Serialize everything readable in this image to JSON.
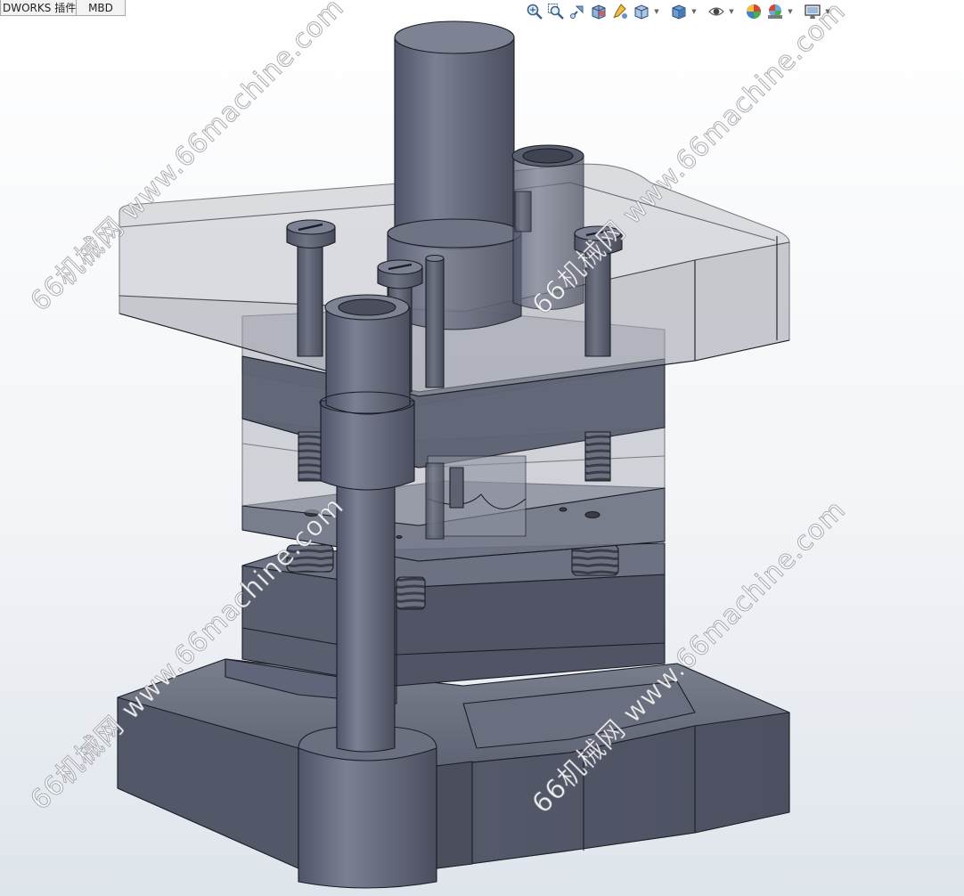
{
  "tabs": [
    {
      "label": "DWORKS 插件"
    },
    {
      "label": "MBD"
    }
  ],
  "heads_up_toolbar": [
    {
      "name": "zoom-to-fit-icon"
    },
    {
      "name": "zoom-to-area-icon"
    },
    {
      "name": "previous-view-icon"
    },
    {
      "name": "section-view-icon"
    },
    {
      "name": "dynamic-annotation-icon"
    },
    {
      "name": "view-orientation-icon",
      "has_dropdown": true
    },
    {
      "name": "display-style-icon",
      "has_dropdown": true
    },
    {
      "name": "hide-show-items-icon",
      "has_dropdown": true
    },
    {
      "name": "edit-appearance-icon"
    },
    {
      "name": "apply-scene-icon",
      "has_dropdown": true
    },
    {
      "name": "view-settings-icon",
      "has_dropdown": true
    }
  ],
  "watermark": {
    "text": "66机械网 www.66machine.com"
  },
  "colors": {
    "part_dark": "#55596a",
    "part_mid": "#6d7282",
    "part_light": "#8c91a0",
    "edge": "#1b1d24",
    "transparent_plate": "#a4a7b0",
    "background_top": "#ffffff",
    "background_bottom": "#dfe5ec"
  }
}
